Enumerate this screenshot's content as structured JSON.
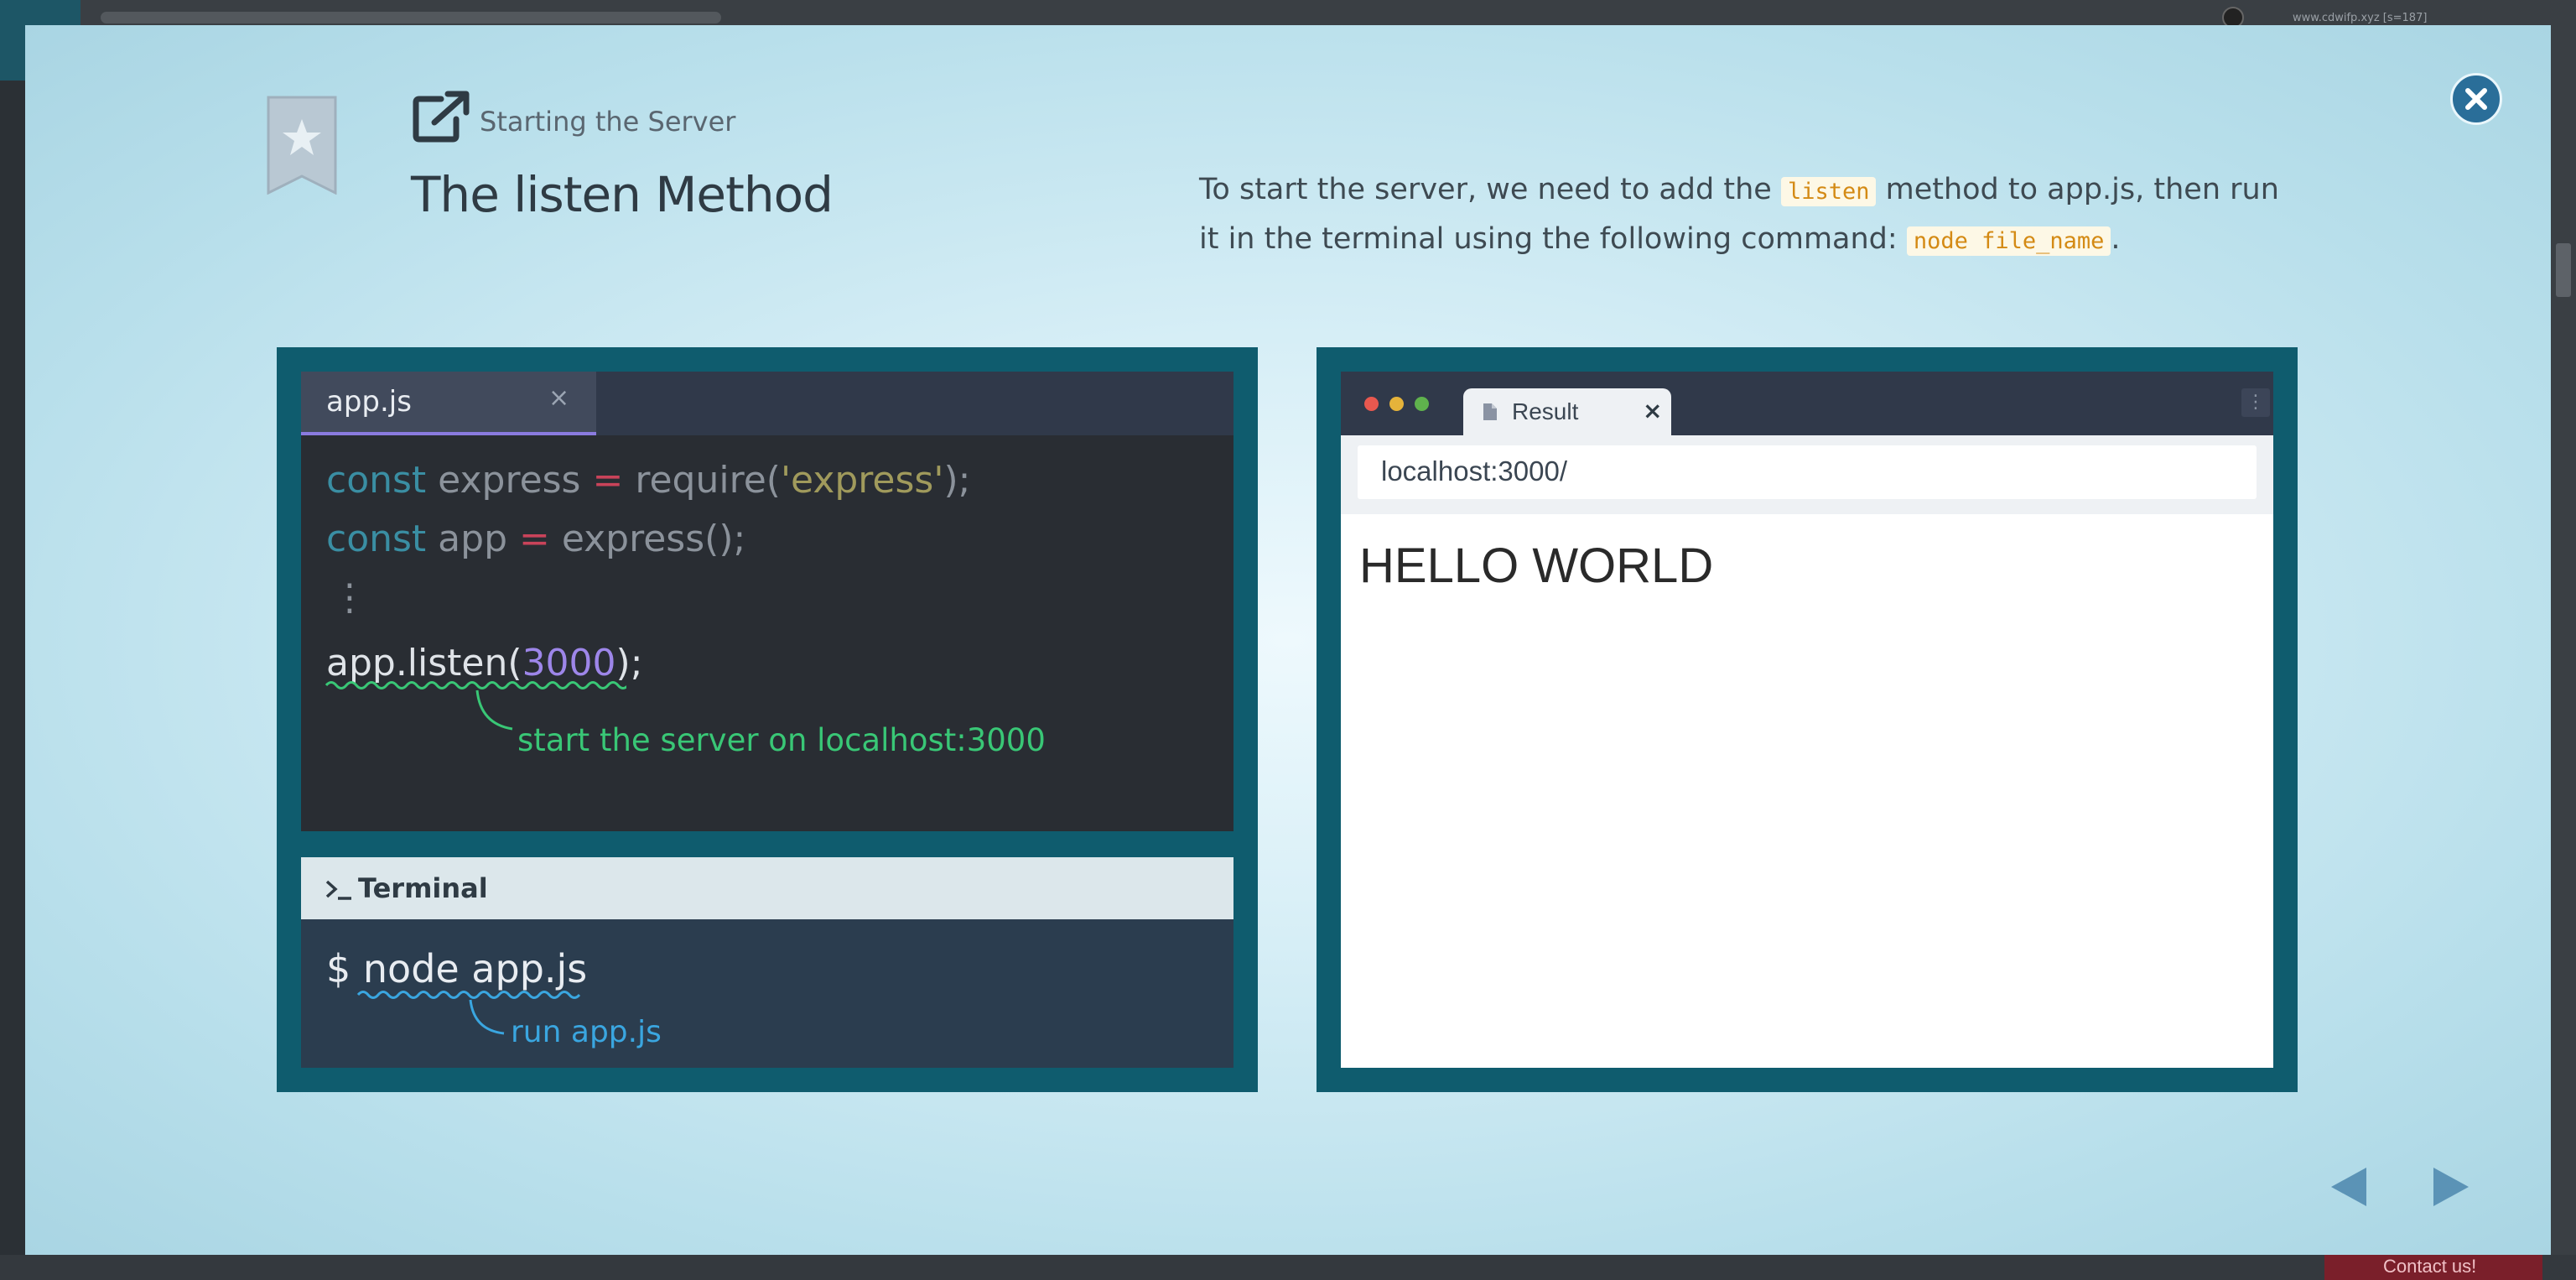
{
  "background": {
    "top_text": "www.cdwifp.xyz [s=187]",
    "contact_label": "Contact us!"
  },
  "slide": {
    "subtitle": "Starting the Server",
    "title": "The listen Method",
    "description": {
      "part1": "To start the server, we need to add the ",
      "code1": "listen",
      "part2": " method to app.js, then run it in the terminal using the following command: ",
      "code2": "node file_name",
      "part3": "."
    }
  },
  "editor": {
    "tab_label": "app.js",
    "tab_close": "×",
    "lines": {
      "l1_kw": "const",
      "l1_var": " express ",
      "l1_op": "=",
      "l1_call": " require(",
      "l1_str": "'express'",
      "l1_end": ");",
      "l2_kw": "const",
      "l2_var": " app ",
      "l2_op": "=",
      "l2_call": " express();",
      "l3": "⋮",
      "l4_pre": "app.listen(",
      "l4_num": "3000",
      "l4_end": ");"
    },
    "annotation": "start the server on localhost:3000"
  },
  "terminal": {
    "title": "Terminal",
    "prompt": "$ ",
    "command": "node app.js",
    "annotation": "run app.js"
  },
  "browser": {
    "tab_label": "Result",
    "tab_close": "×",
    "menu": "⋮",
    "address": "localhost:3000/",
    "content": "HELLO WORLD"
  },
  "colors": {
    "panel": "#0f5c6e",
    "close_button": "#2a6e99",
    "annotation_green": "#39c776",
    "annotation_blue": "#3aa6e0",
    "nav_arrow": "#5b93b6"
  }
}
